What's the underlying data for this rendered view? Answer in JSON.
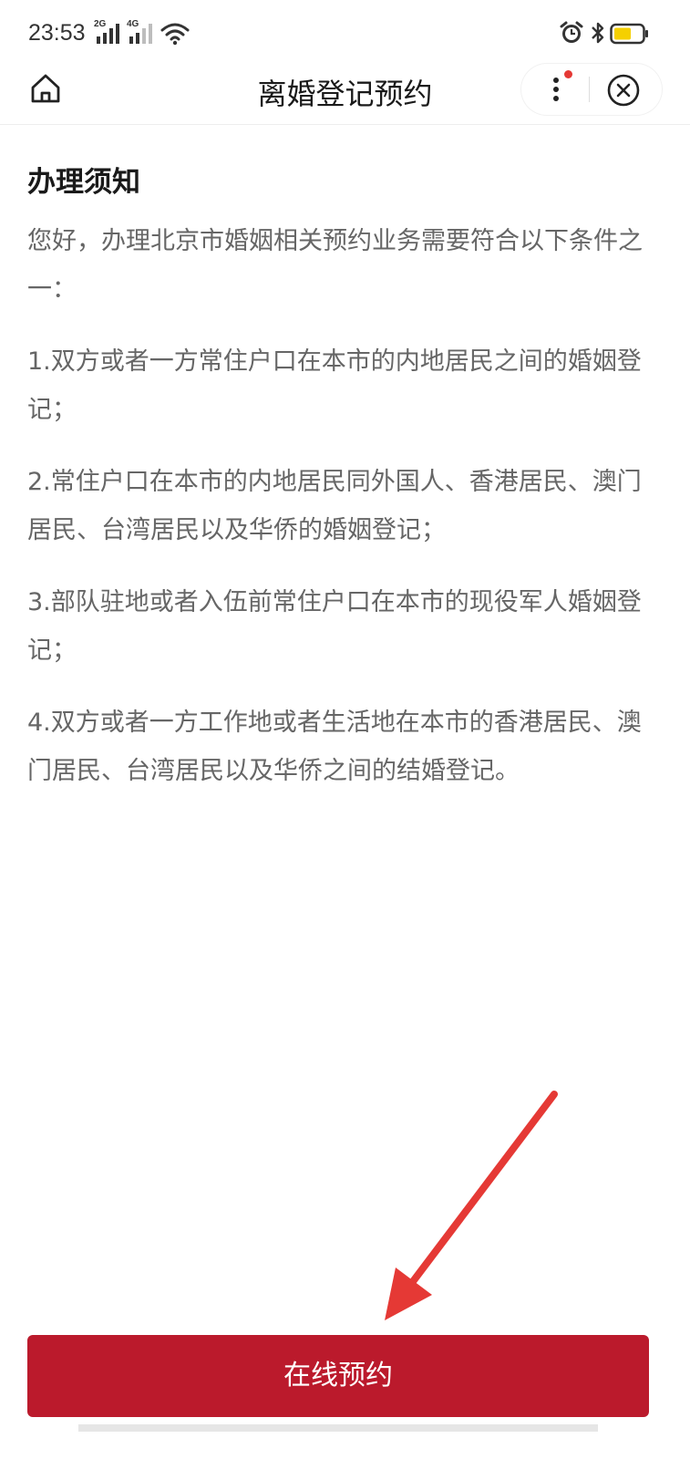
{
  "status_bar": {
    "time": "23:53",
    "signal_1_label": "2G",
    "signal_2_label": "4G"
  },
  "header": {
    "title": "离婚登记预约"
  },
  "content": {
    "heading": "办理须知",
    "intro": "您好，办理北京市婚姻相关预约业务需要符合以下条件之一：",
    "items": [
      "1.双方或者一方常住户口在本市的内地居民之间的婚姻登记；",
      "2.常住户口在本市的内地居民同外国人、香港居民、澳门居民、台湾居民以及华侨的婚姻登记；",
      "3.部队驻地或者入伍前常住户口在本市的现役军人婚姻登记；",
      "4.双方或者一方工作地或者生活地在本市的香港居民、澳门居民、台湾居民以及华侨之间的结婚登记。"
    ]
  },
  "action": {
    "button_label": "在线预约"
  },
  "colors": {
    "primary": "#bb1a2c",
    "arrow": "#e53935",
    "battery_fill": "#f5d000"
  },
  "icons": {
    "home": "home-icon",
    "more": "more-vertical-icon",
    "close": "close-circle-icon",
    "alarm": "alarm-icon",
    "bluetooth": "bluetooth-icon",
    "wifi": "wifi-icon",
    "battery": "battery-icon"
  }
}
